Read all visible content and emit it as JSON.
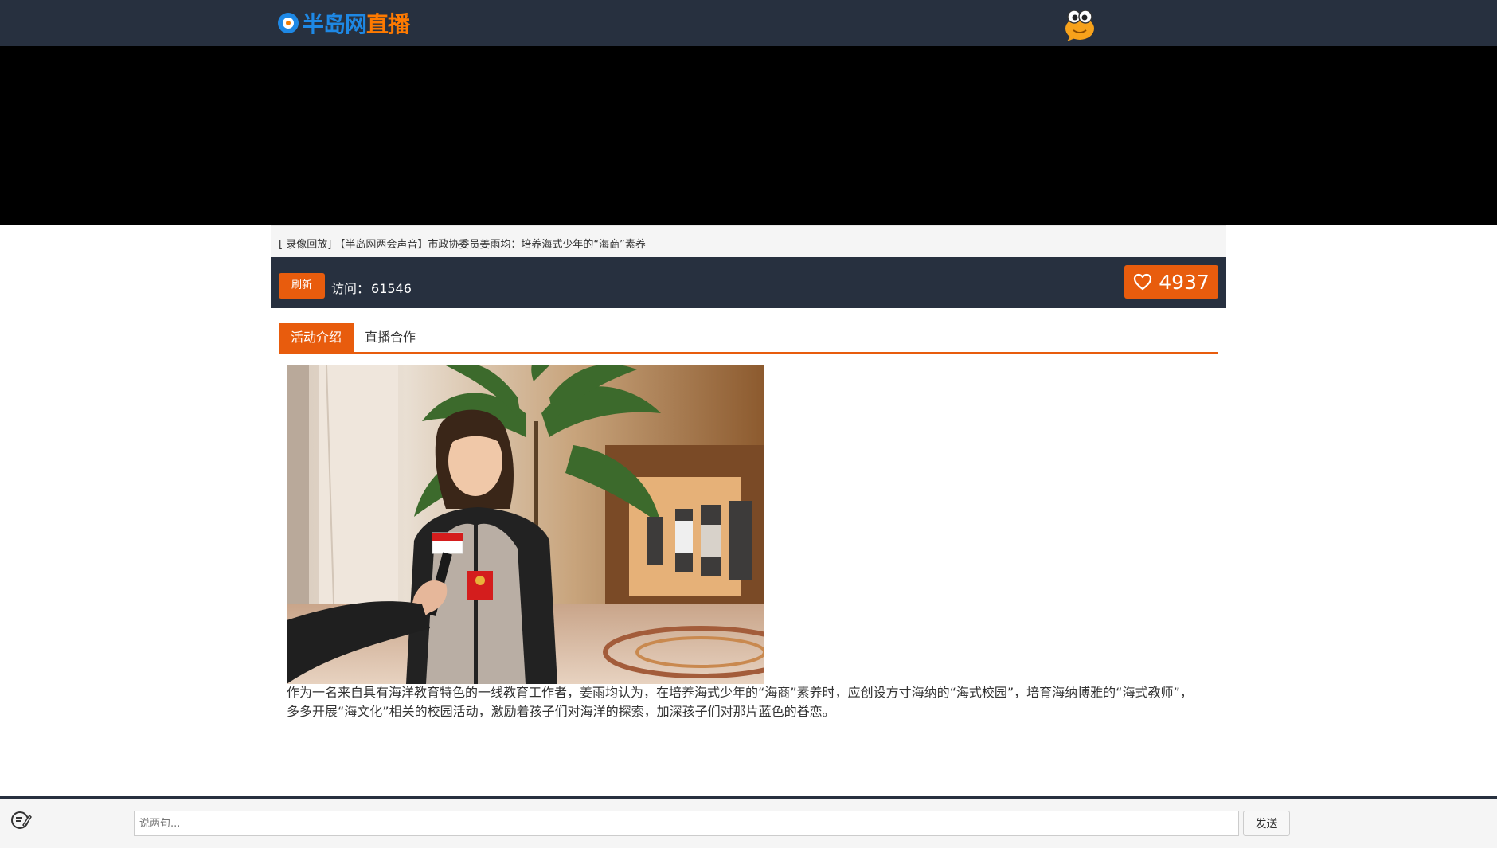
{
  "header": {
    "logo_text_blue": "半岛网",
    "logo_text_orange": "直播",
    "mascot_icon": "mascot-icon"
  },
  "stream": {
    "title": "[ 录像回放] 【半岛网两会声音】市政协委员姜雨均：培养海式少年的“海商”素养"
  },
  "stats": {
    "refresh_label": "刷新",
    "visits_label": "访问：",
    "visits_count": "61546",
    "likes_count": "4937"
  },
  "tabs": [
    {
      "label": "活动介绍",
      "active": true
    },
    {
      "label": "直播合作",
      "active": false
    }
  ],
  "content": {
    "description": "作为一名来自具有海洋教育特色的一线教育工作者，姜雨均认为，在培养海式少年的“海商”素养时，应创设方寸海纳的“海式校园”，培育海纳博雅的“海式教师”，多多开展“海文化”相关的校园活动，激励着孩子们对海洋的探索，加深孩子们对那片蓝色的眷恋。"
  },
  "comment": {
    "placeholder": "说两句...",
    "send_label": "发送"
  },
  "colors": {
    "accent": "#e85c0d",
    "header_bg": "#27303f",
    "logo_blue": "#1e88e5"
  }
}
